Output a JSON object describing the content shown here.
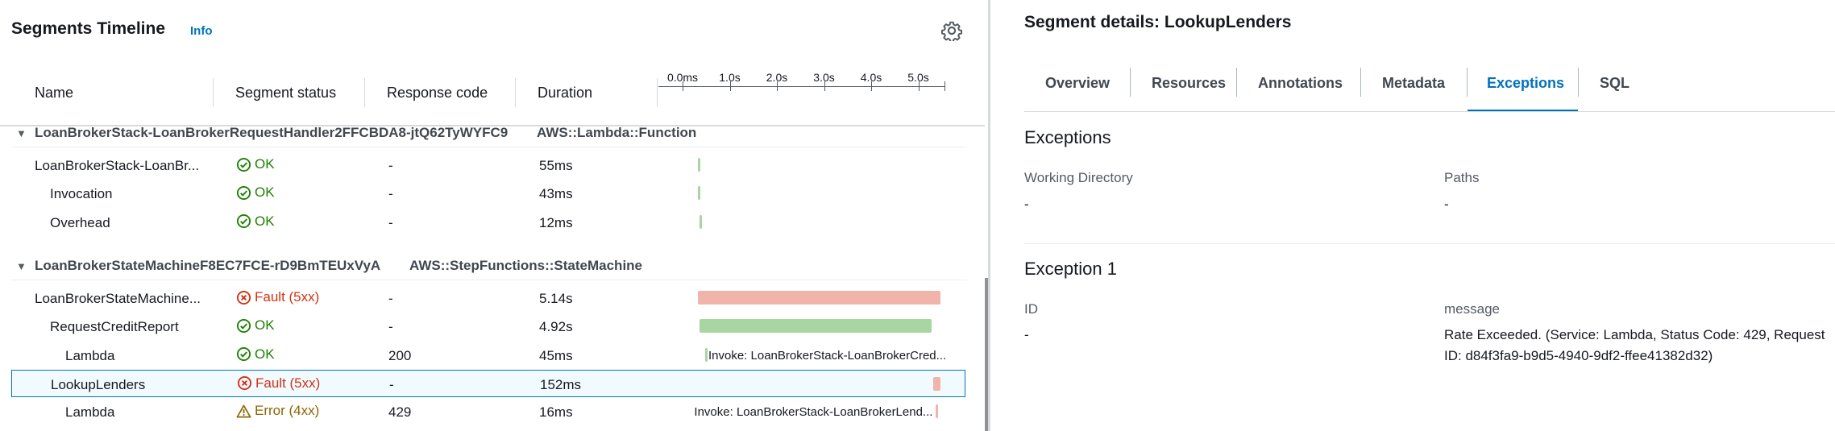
{
  "left_panel": {
    "title": "Segments Timeline",
    "info_link": "Info",
    "columns": [
      "Name",
      "Segment status",
      "Response code",
      "Duration"
    ],
    "scale_ticks": [
      "0.0ms",
      "1.0s",
      "2.0s",
      "3.0s",
      "4.0s",
      "5.0s"
    ],
    "groups": [
      {
        "name": "LoanBrokerStack-LoanBrokerRequestHandler2FFCBDA8-jtQ62TyWYFC9",
        "type": "AWS::Lambda::Function",
        "rows": [
          {
            "name": "LoanBrokerStack-LoanBr...",
            "status": "OK",
            "status_kind": "ok",
            "response": "-",
            "duration": "55ms",
            "bar_start_s": 0.0,
            "bar_duration_s": 0.055,
            "bar_kind": "ok",
            "bar_label": "",
            "indent": 0,
            "selected": false
          },
          {
            "name": "Invocation",
            "status": "OK",
            "status_kind": "ok",
            "response": "-",
            "duration": "43ms",
            "bar_start_s": 0.0,
            "bar_duration_s": 0.043,
            "bar_kind": "ok",
            "bar_label": "",
            "indent": 1,
            "selected": false
          },
          {
            "name": "Overhead",
            "status": "OK",
            "status_kind": "ok",
            "response": "-",
            "duration": "12ms",
            "bar_start_s": 0.04,
            "bar_duration_s": 0.012,
            "bar_kind": "ok",
            "bar_label": "",
            "indent": 1,
            "selected": false
          }
        ]
      },
      {
        "name": "LoanBrokerStateMachineF8EC7FCE-rD9BmTEUxVyA",
        "type": "AWS::StepFunctions::StateMachine",
        "rows": [
          {
            "name": "LoanBrokerStateMachine...",
            "status": "Fault (5xx)",
            "status_kind": "fault",
            "response": "-",
            "duration": "5.14s",
            "bar_start_s": 0.0,
            "bar_duration_s": 5.14,
            "bar_kind": "fault",
            "bar_label": "",
            "indent": 0,
            "selected": false
          },
          {
            "name": "RequestCreditReport",
            "status": "OK",
            "status_kind": "ok",
            "response": "-",
            "duration": "4.92s",
            "bar_start_s": 0.03,
            "bar_duration_s": 4.92,
            "bar_kind": "ok",
            "bar_label": "",
            "indent": 1,
            "selected": false
          },
          {
            "name": "Lambda",
            "status": "OK",
            "status_kind": "ok",
            "response": "200",
            "duration": "45ms",
            "bar_start_s": 0.16,
            "bar_duration_s": 0.045,
            "bar_kind": "ok",
            "bar_label": "Invoke: LoanBrokerStack-LoanBrokerCred...",
            "indent": 2,
            "selected": false
          },
          {
            "name": "LookupLenders",
            "status": "Fault (5xx)",
            "status_kind": "fault",
            "response": "-",
            "duration": "152ms",
            "bar_start_s": 4.98,
            "bar_duration_s": 0.152,
            "bar_kind": "fault",
            "bar_label": "",
            "indent": 1,
            "selected": true
          },
          {
            "name": "Lambda",
            "status": "Error (4xx)",
            "status_kind": "error",
            "response": "429",
            "duration": "16ms",
            "bar_start_s": 5.05,
            "bar_duration_s": 0.016,
            "bar_kind": "fault",
            "bar_label": "Invoke: LoanBrokerStack-LoanBrokerLend...",
            "indent": 2,
            "selected": false
          }
        ]
      }
    ]
  },
  "right_panel": {
    "title": "Segment details: LookupLenders",
    "tabs": [
      {
        "label": "Overview",
        "active": false
      },
      {
        "label": "Resources",
        "active": false
      },
      {
        "label": "Annotations",
        "active": false
      },
      {
        "label": "Metadata",
        "active": false
      },
      {
        "label": "Exceptions",
        "active": true
      },
      {
        "label": "SQL",
        "active": false
      }
    ],
    "exceptions": {
      "title": "Exceptions",
      "working_directory_label": "Working Directory",
      "working_directory_value": "-",
      "paths_label": "Paths",
      "paths_value": "-"
    },
    "exception_1": {
      "title": "Exception 1",
      "id_label": "ID",
      "id_value": "-",
      "message_label": "message",
      "message_value": "Rate Exceeded. (Service: Lambda, Status Code: 429, Request ID: d84f3fa9-b9d5-4940-9df2-ffee41382d32)"
    }
  },
  "colors": {
    "link": "#0073bb",
    "ok": "#1d8102",
    "fault": "#d13212",
    "error": "#8d6605",
    "bar_ok": "#a8d5a0",
    "bar_fault": "#f0b4aa"
  },
  "icons": {
    "ok": "check-circle-icon",
    "fault": "x-circle-icon",
    "error": "warning-triangle-icon",
    "settings": "gear-icon",
    "expand": "caret-down-icon"
  }
}
